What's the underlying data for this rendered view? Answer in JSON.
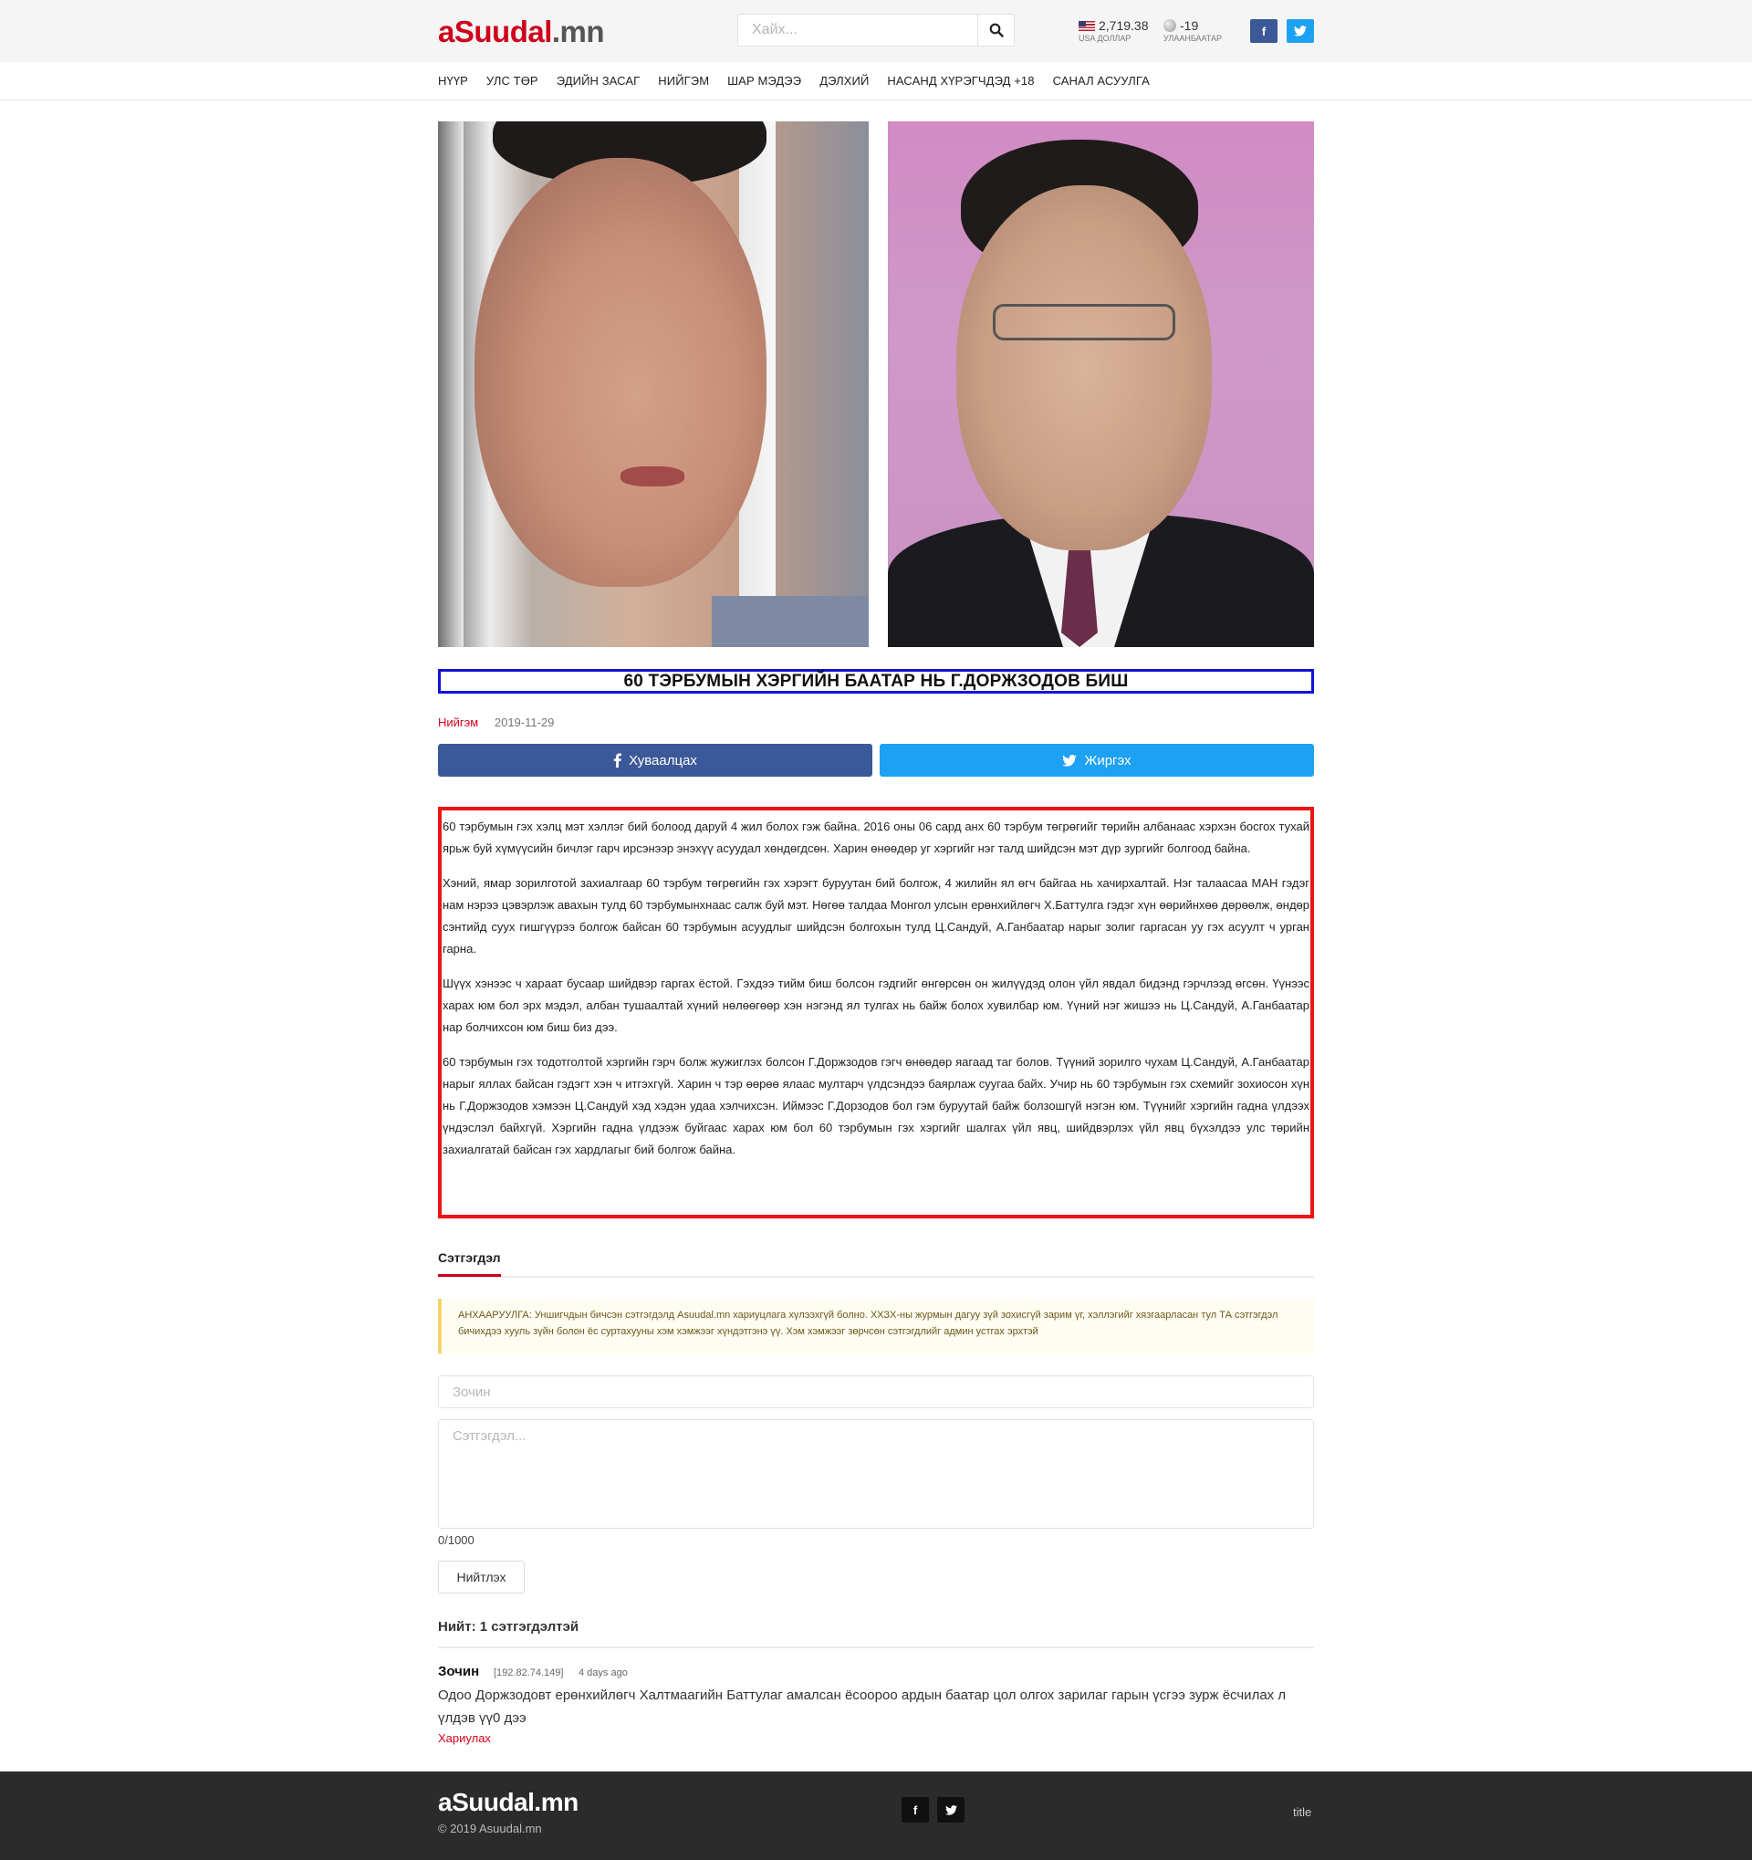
{
  "header": {
    "logo_prefix": "a",
    "logo_mark": "Ѕ",
    "logo_main": "uudal",
    "logo_suffix": ".mn",
    "search_placeholder": "Хайх...",
    "usd_value": "2,719.38",
    "usd_label": "USA ДОЛЛАР",
    "temp_value": "-19",
    "temp_label": "УЛААНБААТАР",
    "facebook_icon": "f",
    "twitter_icon": "t"
  },
  "nav": {
    "items": [
      "НҮҮР",
      "УЛС ТӨР",
      "ЭДИЙН ЗАСАГ",
      "НИЙГЭМ",
      "ШАР МЭДЭЭ",
      "ДЭЛХИЙ",
      "НАСАНД ХҮРЭГЧДЭД +18",
      "САНАЛ АСУУЛГА"
    ]
  },
  "article": {
    "title": "60 ТЭРБУМЫН ХЭРГИЙН БААТАР НЬ Г.ДОРЖЗОДОВ БИШ",
    "category": "Нийгэм",
    "date": "2019-11-29",
    "share_facebook": "Хуваалцах",
    "share_twitter": "Жиргэх",
    "paragraphs": [
      "60 тэрбумын гэх хэлц мэт хэллэг бий болоод даруй 4 жил болох гэж байна. 2016 оны 06 сард анх 60 тэрбум төгрөгийг төрийн албанаас хэрхэн босгох тухай ярьж буй хүмүүсийн бичлэг гарч ирсэнээр энэхүү асуудал хөндөгдсөн. Харин өнөөдөр уг хэргийг нэг талд шийдсэн мэт дүр зургийг болгоод байна.",
      "Хэний, ямар зорилготой захиалгаар 60 тэрбум төгрөгийн гэх хэрэгт буруутан бий болгож, 4 жилийн ял өгч байгаа нь хачирхалтай. Нэг талаасаа МАН гэдэг нам нэрээ цэвэрлэж авахын тулд 60 тэрбумынхнаас салж буй мэт. Нөгөө талдаа Монгол улсын ерөнхийлөгч Х.Баттулга гэдэг хүн өөрийнхөө дөрөөлж, өндөр сэнтийд суух гишгүүрээ болгож байсан 60 тэрбумын асуудлыг шийдсэн болгохын тулд Ц.Сандуй, А.Ганбаатар нарыг золиг гаргасан уу гэх асуулт ч урган гарна.",
      "Шүүх хэнээс ч хараат бусаар шийдвэр гаргах ёстой. Гэхдээ тийм биш болсон гэдгийг өнгөрсөн он жилүүдэд олон үйл явдал бидэнд гэрчлээд өгсөн. Үүнээс харах юм бол эрх мэдэл, албан тушаалтай хүний нөлөөгөөр хэн нэгэнд ял тулгах нь байж болох хувилбар юм. Үүний нэг жишээ нь Ц.Сандуй, А.Ганбаатар нар болчихсон юм биш биз дээ.",
      "60 тэрбумын гэх тодотголтой хэргийн гэрч болж жужиглэх болсон Г.Доржзодов гэгч өнөөдөр яагаад таг болов. Түүний зорилго чухам Ц.Сандуй, А.Ганбаатар нарыг яллах байсан гэдэгт хэн ч итгэхгүй. Харин ч тэр өөрөө ялаас мултарч үлдсэндээ баярлаж суугаа байх. Учир нь 60 тэрбумын гэх схемийг зохиосон хүн нь Г.Доржзодов хэмээн Ц.Сандуй хэд хэдэн удаа хэлчихсэн. Иймээс Г.Дорзодов бол гэм буруутай байж болзошгүй нэгэн юм. Түүнийг хэргийн гадна үлдээх үндэслэл байхгүй. Хэргийн гадна үлдээж буйгаас харах юм бол 60 тэрбумын гэх хэргийг шалгах үйл явц, шийдвэрлэх үйл явц бүхэлдээ улс төрийн захиалгатай байсан гэх хардлагыг бий болгож байна."
    ]
  },
  "comments": {
    "tab_label": "Сэтгэгдэл",
    "warning": "АНХААРУУЛГА: Уншигчдын бичсэн сэтгэгдэлд Asuudal.mn хариуцлага хүлээхгүй болно. ХХЗХ-ны журмын дагуу зүй зохисгүй зарим үг, хэллэгийг хязгаарласан тул ТА сэтгэгдэл бичихдээ хууль зүйн болон ёс суртахууны хэм хэмжээг хүндэтгэнэ үү. Хэм хэмжээг зөрчсөн сэтгэгдлийг админ устгах эрхтэй",
    "name_placeholder": "Зочин",
    "text_placeholder": "Сэтгэгдэл...",
    "counter": "0/1000",
    "post_button": "Нийтлэх",
    "total": "Нийт: 1 сэтгэгдэлтэй",
    "items": [
      {
        "author": "Зочин",
        "ip": "[192.82.74.149]",
        "ago": "4 days ago",
        "text": "Одоо Доржзодовт ерөнхийлөгч Халтмаагийн Баттулаг амалсан ёсоороо ардын баатар цол олгох зарилаг гарын үсгээ зурж ёсчилах л үлдэв үү0 дээ",
        "reply": "Хариулах"
      }
    ]
  },
  "footer": {
    "logo": "aЅuudal.mn",
    "copyright": "© 2019 Asuudal.mn",
    "title": "title"
  },
  "colors": {
    "brand_red": "#d0021b",
    "facebook": "#3b5998",
    "twitter": "#1da1f2",
    "title_border": "#1212d6",
    "article_border": "#ec1414"
  }
}
